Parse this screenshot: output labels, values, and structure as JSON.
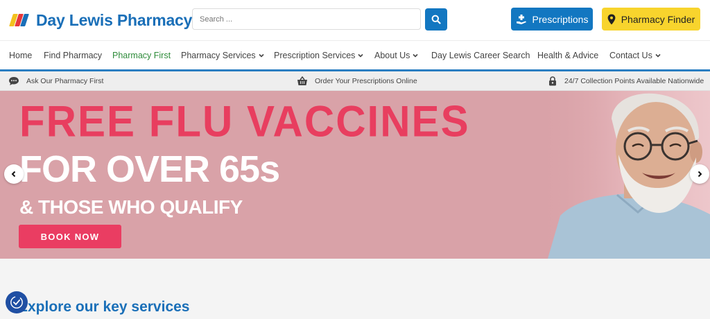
{
  "colors": {
    "brand_blue": "#1a6fb8",
    "button_blue": "#1277c1",
    "button_yellow": "#f8d42d",
    "nav_active_green": "#2e8b3a",
    "hero_bg": "#d9a2a8",
    "hero_red": "#e83e5f",
    "book_button": "#ea3d62",
    "accent_line": "#2a7ec2"
  },
  "header": {
    "logo_text": "Day Lewis Pharmacy",
    "logo_icon": "striped-logo-icon",
    "search_placeholder": "Search ...",
    "search_icon": "search-icon",
    "prescriptions_label": "Prescriptions",
    "prescriptions_icon": "hand-plus-icon",
    "finder_label": "Pharmacy Finder",
    "finder_icon": "map-pin-icon"
  },
  "nav": {
    "items": [
      {
        "label": "Home",
        "active": false,
        "dropdown": false
      },
      {
        "label": "Find Pharmacy",
        "active": false,
        "dropdown": false
      },
      {
        "label": "Pharmacy First",
        "active": true,
        "dropdown": false
      },
      {
        "label": "Pharmacy Services",
        "active": false,
        "dropdown": true
      },
      {
        "label": "Prescription Services",
        "active": false,
        "dropdown": true
      },
      {
        "label": "About Us",
        "active": false,
        "dropdown": true
      },
      {
        "label": "Day Lewis Career Search",
        "active": false,
        "dropdown": false
      },
      {
        "label": "Health & Advice",
        "active": false,
        "dropdown": false
      },
      {
        "label": "Contact Us",
        "active": false,
        "dropdown": true
      }
    ]
  },
  "info_bar": {
    "items": [
      {
        "label": "Ask Our Pharmacy First",
        "icon": "chat-bubble-icon"
      },
      {
        "label": "Order Your Prescriptions Online",
        "icon": "basket-icon"
      },
      {
        "label": "24/7 Collection Points Available Nationwide",
        "icon": "lock-icon"
      }
    ]
  },
  "hero": {
    "headline": "FREE FLU VACCINES",
    "subline": "FOR OVER 65s",
    "tagline": "& THOSE WHO QUALIFY",
    "cta_label": "BOOK NOW"
  },
  "main": {
    "section_title": "Explore our key services"
  }
}
